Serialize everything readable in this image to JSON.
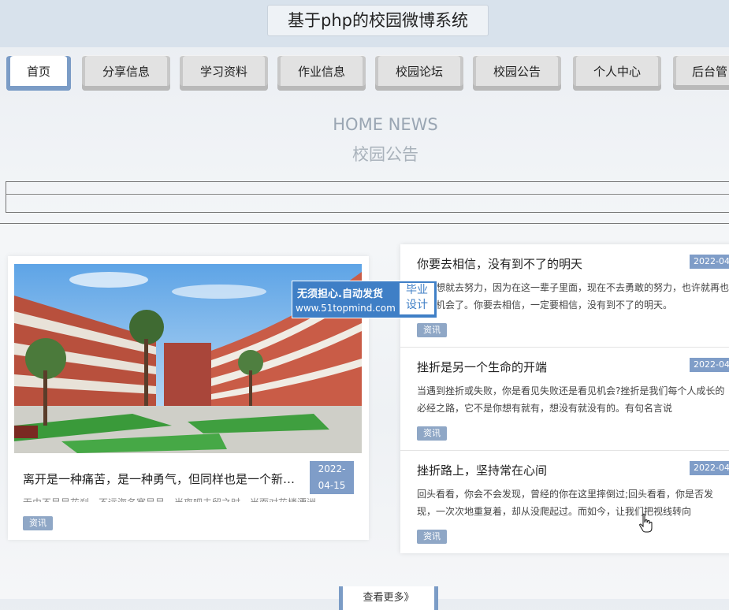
{
  "header": {
    "title": "基于php的校园微博系统"
  },
  "nav": {
    "items": [
      "首页",
      "分享信息",
      "学习资料",
      "作业信息",
      "校园论坛",
      "校园公告",
      "个人中心",
      "后台管"
    ],
    "active": "首页"
  },
  "section": {
    "title_en": "HOME NEWS",
    "title_cn": "校园公告"
  },
  "featured": {
    "title": "离开是一种痛苦，是一种勇气，但同样也是一个新的开始",
    "date": "2022-04-15",
    "date_line1": "2022-",
    "date_line2": "04-15",
    "excerpt": "无由不是是花刹，不远海名塞是是，当离吧去留之时，当而对花楼漂洲",
    "tag": "资讯"
  },
  "news": [
    {
      "title": "你要去相信，没有到不了的明天",
      "date": "2022-04",
      "excerpt": "有梦想就去努力，因为在这一辈子里面，现在不去勇敢的努力，也许就再也没有机会了。你要去相信，一定要相信，没有到不了的明天。",
      "tag": "资讯"
    },
    {
      "title": "挫折是另一个生命的开端",
      "date": "2022-04",
      "excerpt": "当遇到挫折或失败，你是看见失败还是看见机会?挫折是我们每个人成长的必经之路，它不是你想有就有，想没有就没有的。有句名言说",
      "tag": "资讯"
    },
    {
      "title": "挫折路上，坚持常在心间",
      "date": "2022-04",
      "excerpt": "回头看看，你会不会发现，曾经的你在这里摔倒过;回头看看，你是否发现，一次次地重复着，却从没爬起过。而如今，让我们把视线转向",
      "tag": "资讯"
    }
  ],
  "watermark": {
    "line1": "无须担心.自动发货",
    "line2": "www.51topmind.com",
    "badge_line1": "毕业",
    "badge_line2": "设计"
  },
  "more_button": "查看更多》"
}
